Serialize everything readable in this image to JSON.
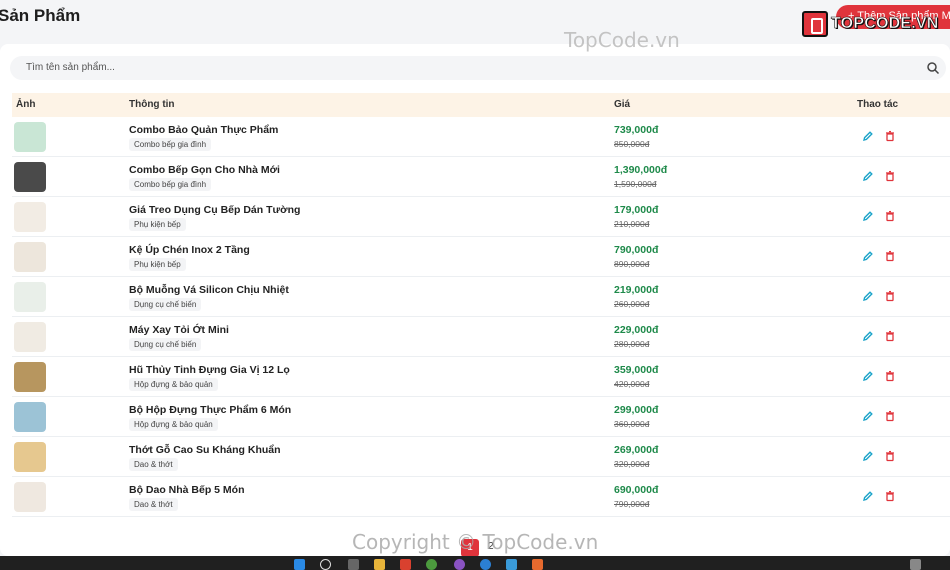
{
  "page": {
    "title": "Sản Phẩm",
    "add_button_label": "+ Thêm Sản phẩm Mới"
  },
  "logo": {
    "text": "TOPCODE.VN"
  },
  "watermark": {
    "top": "TopCode.vn",
    "bottom": "Copyright © TopCode.vn"
  },
  "search": {
    "placeholder": "Tìm tên sản phẩm..."
  },
  "table": {
    "headers": {
      "image": "Ảnh",
      "info": "Thông tin",
      "price": "Giá",
      "actions": "Thao tác"
    },
    "rows": [
      {
        "name": "Combo Bảo Quản Thực Phẩm",
        "category": "Combo bếp gia đình",
        "price": "739,000đ",
        "old_price": "850,000đ",
        "thumb_color": "#c9e6d5"
      },
      {
        "name": "Combo Bếp Gọn Cho Nhà Mới",
        "category": "Combo bếp gia đình",
        "price": "1,390,000đ",
        "old_price": "1,590,000đ",
        "thumb_color": "#4a4a4a"
      },
      {
        "name": "Giá Treo Dụng Cụ Bếp Dán Tường",
        "category": "Phụ kiện bếp",
        "price": "179,000đ",
        "old_price": "210,000đ",
        "thumb_color": "#f2ece4"
      },
      {
        "name": "Kệ Úp Chén Inox 2 Tầng",
        "category": "Phụ kiện bếp",
        "price": "790,000đ",
        "old_price": "890,000đ",
        "thumb_color": "#ede6dc"
      },
      {
        "name": "Bộ Muỗng Vá Silicon Chịu Nhiệt",
        "category": "Dụng cụ chế biến",
        "price": "219,000đ",
        "old_price": "260,000đ",
        "thumb_color": "#e9efe9"
      },
      {
        "name": "Máy Xay Tỏi Ớt Mini",
        "category": "Dụng cụ chế biến",
        "price": "229,000đ",
        "old_price": "280,000đ",
        "thumb_color": "#f0ebe3"
      },
      {
        "name": "Hũ Thủy Tinh Đựng Gia Vị 12 Lọ",
        "category": "Hộp đựng & bảo quản",
        "price": "359,000đ",
        "old_price": "420,000đ",
        "thumb_color": "#b7965f"
      },
      {
        "name": "Bộ Hộp Đựng Thực Phẩm 6 Món",
        "category": "Hộp đựng & bảo quản",
        "price": "299,000đ",
        "old_price": "360,000đ",
        "thumb_color": "#9cc3d6"
      },
      {
        "name": "Thớt Gỗ Cao Su Kháng Khuẩn",
        "category": "Dao & thớt",
        "price": "269,000đ",
        "old_price": "320,000đ",
        "thumb_color": "#e6c88f"
      },
      {
        "name": "Bộ Dao Nhà Bếp 5 Món",
        "category": "Dao & thớt",
        "price": "690,000đ",
        "old_price": "790,000đ",
        "thumb_color": "#efe8e0"
      }
    ]
  },
  "pagination": {
    "pages": [
      "1",
      "2"
    ],
    "current": "1"
  },
  "colors": {
    "accent": "#e0343c",
    "price_green": "#1e8a4a",
    "header_bg": "#fdf3e6",
    "edit_icon": "#1aa3c9",
    "delete_icon": "#e0343c"
  }
}
